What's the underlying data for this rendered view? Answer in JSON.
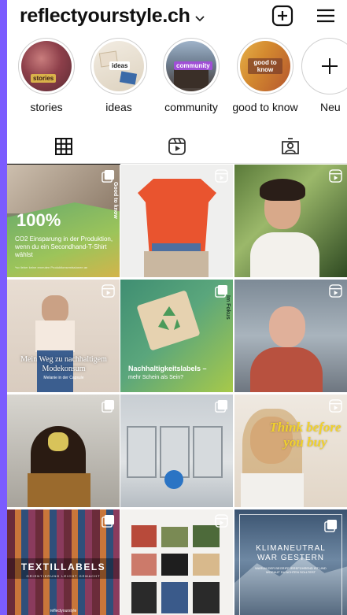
{
  "header": {
    "account_name": "reflectyourstyle.ch",
    "chevron": "chevron-down-icon",
    "add_icon": "plus-square-icon",
    "menu_icon": "hamburger-menu-icon"
  },
  "highlights": [
    {
      "label": "stories",
      "cover_text": "stories"
    },
    {
      "label": "ideas",
      "cover_text": "ideas"
    },
    {
      "label": "community",
      "cover_text": "community"
    },
    {
      "label": "good to know",
      "cover_text": "good to know"
    },
    {
      "label": "Neu",
      "cover_text": "+"
    }
  ],
  "tabs": [
    {
      "name": "posts-grid",
      "icon": "grid-icon",
      "active": true
    },
    {
      "name": "reels",
      "icon": "reels-icon",
      "active": false
    },
    {
      "name": "tagged",
      "icon": "tagged-person-icon",
      "active": false
    }
  ],
  "posts": [
    {
      "type": "carousel",
      "title": "100%",
      "side_label": "Good to know",
      "body": "CO2 Einsparung in der Produktion, wenn du ein Secondhand-T-Shirt wählst",
      "footnote": "*so lieber keine erneuten Produktionsemissionen an"
    },
    {
      "type": "reel"
    },
    {
      "type": "reel"
    },
    {
      "type": "reel",
      "title": "Mein Weg zu nachhaltigem Modekonsum",
      "subtitle": "Melanie in der Capsule"
    },
    {
      "type": "carousel",
      "title": "Nachhaltigkeitslabels –",
      "subtitle": "mehr Schein als Sein?",
      "side_label": "Im Fokus"
    },
    {
      "type": "reel"
    },
    {
      "type": "carousel"
    },
    {
      "type": "carousel"
    },
    {
      "type": "reel",
      "title": "Think before you buy"
    },
    {
      "type": "carousel",
      "title": "TEXTILLABELS",
      "subtitle": "ORIENTIERUNG LEICHT GEMACHT",
      "footer": "reflectyourstyle"
    },
    {
      "type": "reel"
    },
    {
      "type": "carousel",
      "title": "KLIMANEUTRAL WAR GESTERN",
      "subtitle": "WARUM DER BEGRIFF IRREFÜHREND IST UND WORAUF DU ACHTEN SOLLTEST"
    }
  ],
  "colors": {
    "accent": "#111111",
    "frame": "#8a4fe8",
    "green_card": "#a7c94a"
  }
}
